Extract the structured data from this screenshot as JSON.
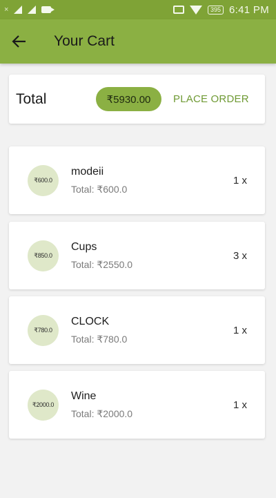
{
  "status_bar": {
    "left_x": "×",
    "battery": "395",
    "time": "6:41 PM"
  },
  "app_bar": {
    "title": "Your Cart"
  },
  "total": {
    "label": "Total",
    "amount": "₹5930.00",
    "place_order": "PLACE ORDER"
  },
  "items": [
    {
      "badge": "₹600.0",
      "name": "modeii",
      "total": "Total: ₹600.0",
      "qty": "1 x"
    },
    {
      "badge": "₹850.0",
      "name": "Cups",
      "total": "Total: ₹2550.0",
      "qty": "3 x"
    },
    {
      "badge": "₹780.0",
      "name": "CLOCK",
      "total": "Total: ₹780.0",
      "qty": "1 x"
    },
    {
      "badge": "₹2000.0",
      "name": "Wine",
      "total": "Total: ₹2000.0",
      "qty": "1 x"
    }
  ],
  "colors": {
    "status_bar": "#7fa336",
    "app_bar": "#8bb043",
    "accent_text": "#6f9a34",
    "badge_bg": "#dfe8c9"
  }
}
